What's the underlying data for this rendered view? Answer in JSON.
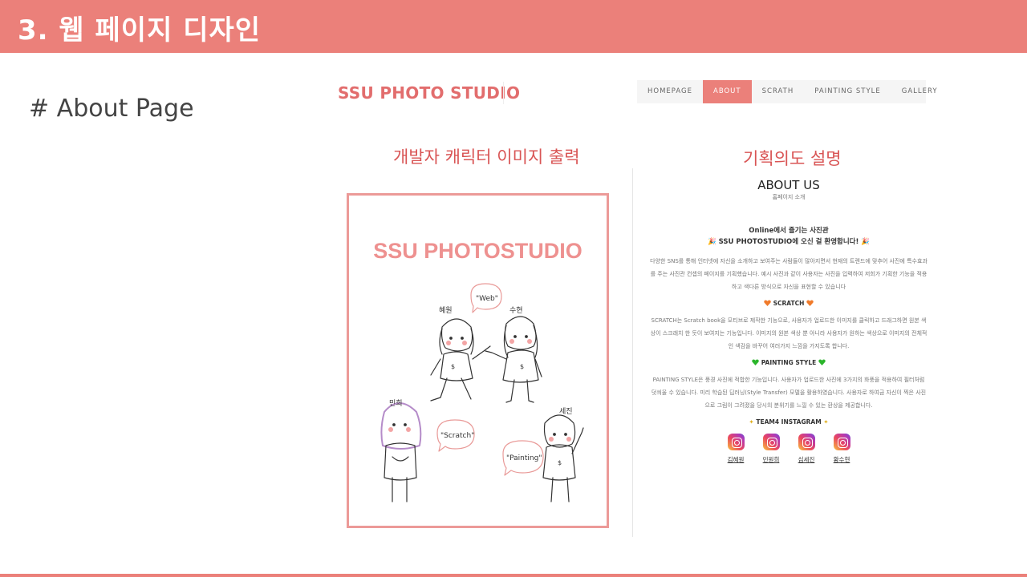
{
  "slide": {
    "header_title": "3. 웹 페이지 디자인",
    "section_label": "# About Page",
    "caption_left": "개발자 캐릭터 이미지 출력",
    "caption_right": "기획의도 설명"
  },
  "site": {
    "brand": "SSU PHOTO STUDIO",
    "nav": [
      {
        "label": "HOMEPAGE",
        "active": false
      },
      {
        "label": "ABOUT",
        "active": true
      },
      {
        "label": "SCRATH",
        "active": false
      },
      {
        "label": "PAINTING STYLE",
        "active": false
      },
      {
        "label": "GALLERY",
        "active": false
      }
    ],
    "accent_color": "#eb807a"
  },
  "character_image": {
    "title": "SSU PHOTOSTUDIO",
    "bubbles": [
      "\"Web\"",
      "\"Scratch\"",
      "\"Painting\""
    ],
    "names": [
      "혜원",
      "수현",
      "민희",
      "세진"
    ]
  },
  "about": {
    "title": "ABOUT US",
    "subtitle": "홈페이지 소개",
    "intro_line1": "Online에서 즐기는 사진관",
    "intro_line2": "🎉 SSU PHOTOSTUDIO에 오신 걸 환영합니다! 🎉",
    "intro_para": "다양한 SNS를 통해 인터넷에 자신을 소개하고 보여주는 사람들이 많아지면서 현재의 트렌드에 맞추어 사진에 특수효과를 주는 사진관 컨셉의 페이지를 기획했습니다. 예시 사진과 같이 사용자는 사진을 입력하여 저희가 기획한 기능을 적용하고 색다른 방식으로 자신을 표현할 수 있습니다",
    "scratch_head": "SCRATCH",
    "scratch_para": "SCRATCH는 Scratch book을 모티브로 제작한 기능으로, 사용자가 업로드한 이미지를 클릭하고 드래그하면 원본 색상이 스크래치 한 듯이 보여지는 기능입니다. 이미지의 원본 색상 뿐 아니라 사용자가 원하는 색상으로 이미지의 전체적인 색감을 바꾸어 여러가지 느낌을 가지도록 합니다.",
    "painting_head": "PAINTING STYLE",
    "painting_para": "PAINTING STYLE은 풍경 사진에 적합한 기능입니다. 사용자가 업로드한 사진에 3가지의 화풍을 적용하여 필터처럼 덧씌울 수 있습니다. 미리 학습된 딥러닝(Style Transfer) 모델을 활용하였습니다. 사용자로 하여금 자신이 찍은 사진으로 그림이 그려졌을 당시의 분위기를 느낄 수 있는 환상을 제공합니다.",
    "instagram_head": "TEAM4 INSTAGRAM",
    "members": [
      "김혜원",
      "민원희",
      "심세진",
      "황수현"
    ]
  }
}
